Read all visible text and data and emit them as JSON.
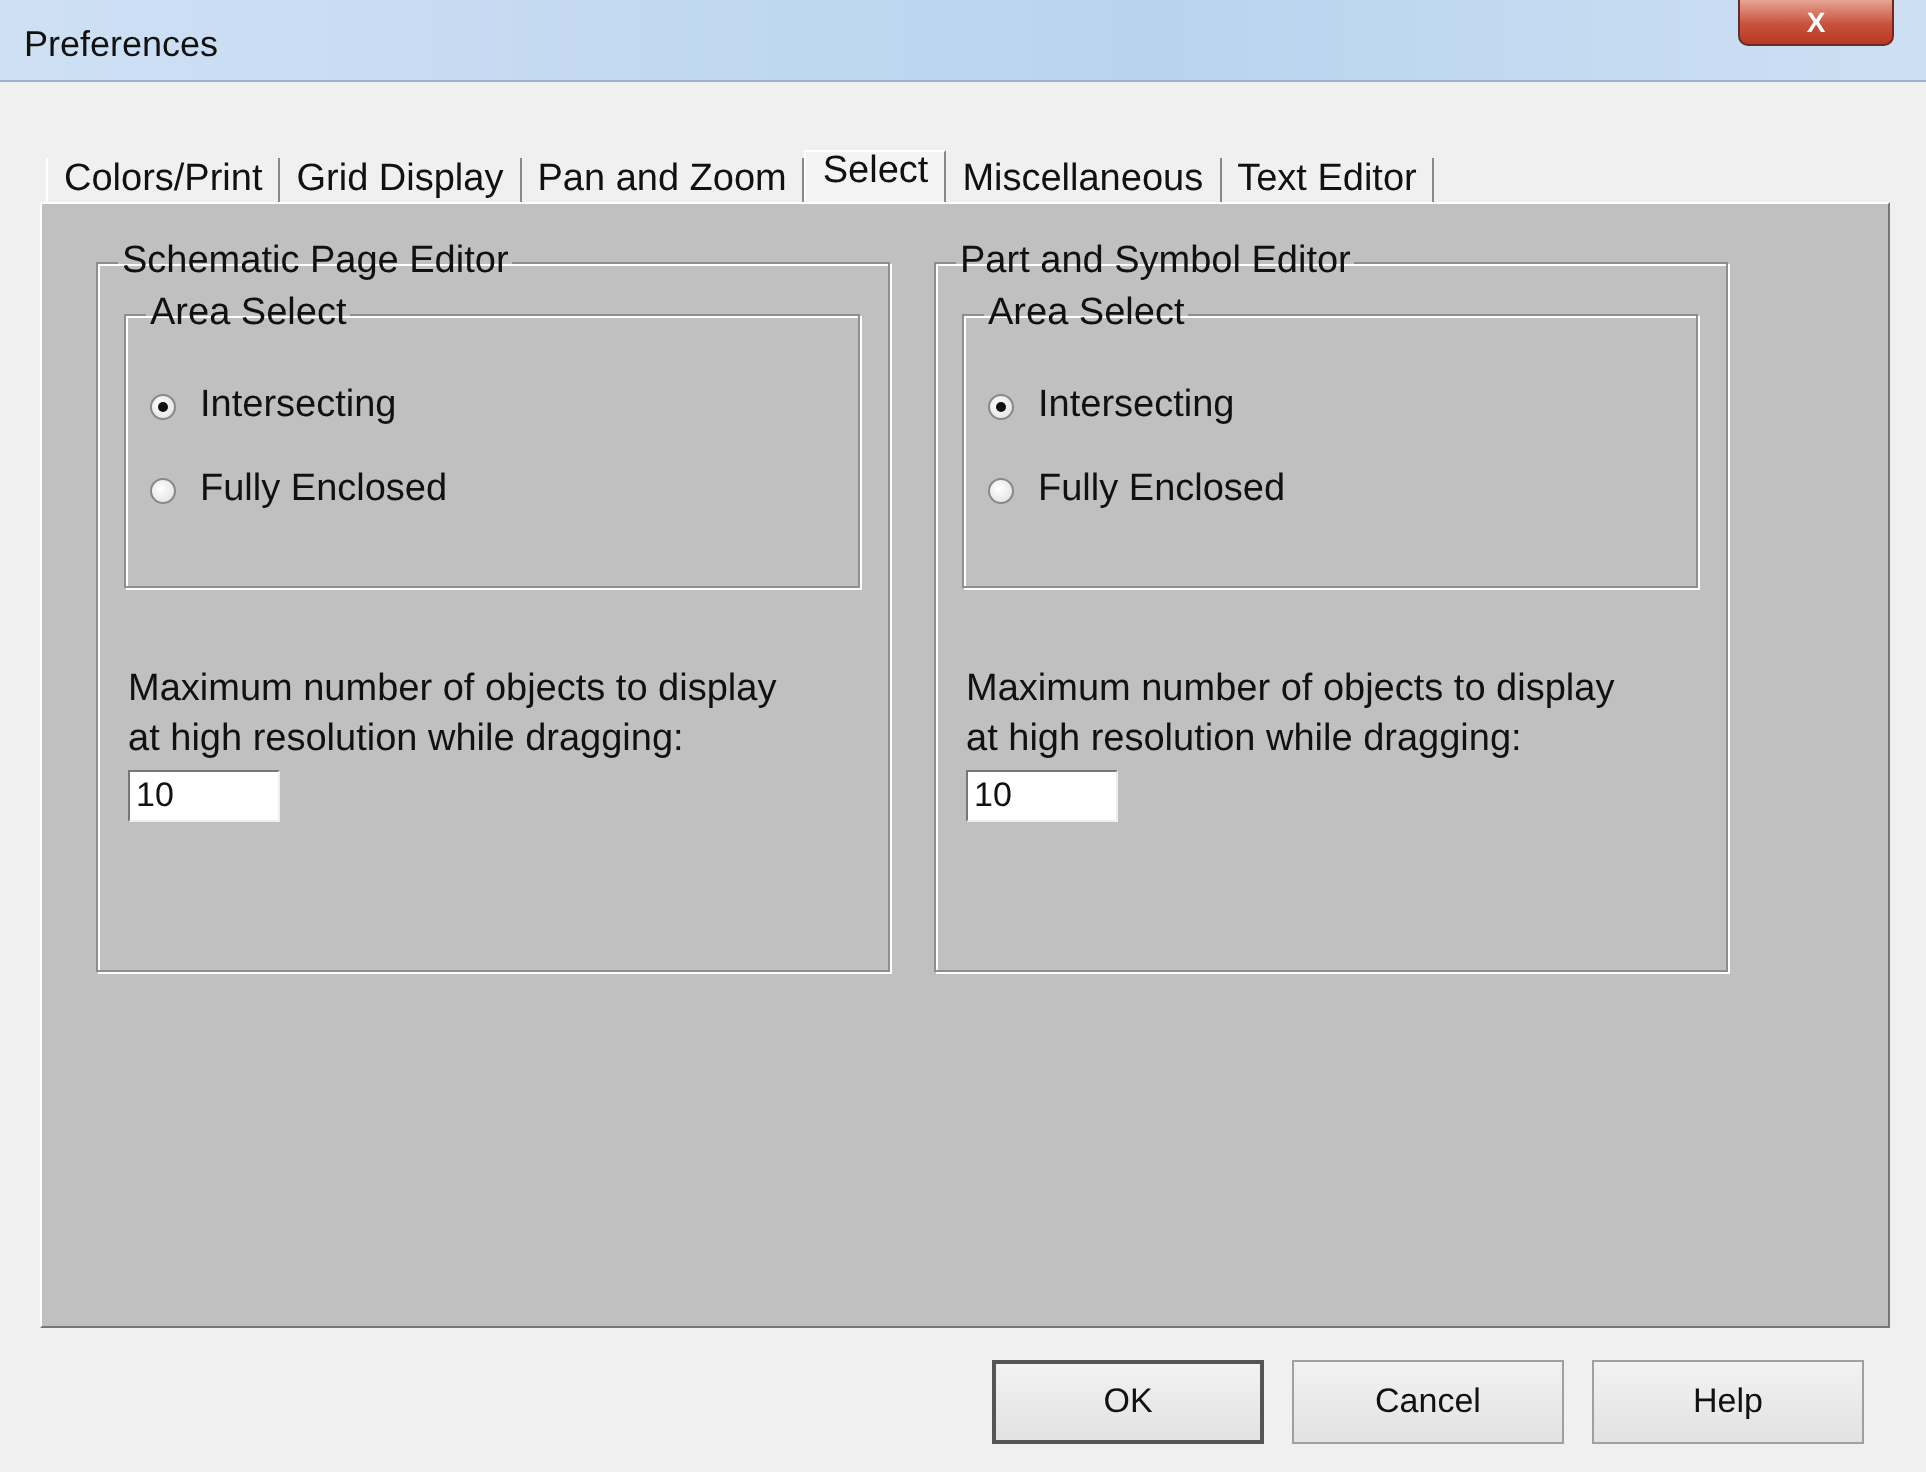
{
  "window": {
    "title": "Preferences",
    "close_label": "X"
  },
  "tabs": [
    {
      "label": "Colors/Print",
      "selected": false
    },
    {
      "label": "Grid Display",
      "selected": false
    },
    {
      "label": "Pan and Zoom",
      "selected": false
    },
    {
      "label": "Select",
      "selected": true
    },
    {
      "label": "Miscellaneous",
      "selected": false
    },
    {
      "label": "Text Editor",
      "selected": false
    }
  ],
  "groups": [
    {
      "title": "Schematic Page Editor",
      "area_select": {
        "title": "Area Select",
        "options": [
          {
            "label": "Intersecting",
            "selected": true
          },
          {
            "label": "Fully Enclosed",
            "selected": false
          }
        ]
      },
      "max_objects_label": "Maximum number of objects to display at high resolution while dragging:",
      "max_objects_value": "10"
    },
    {
      "title": "Part and Symbol Editor",
      "area_select": {
        "title": "Area Select",
        "options": [
          {
            "label": "Intersecting",
            "selected": true
          },
          {
            "label": "Fully Enclosed",
            "selected": false
          }
        ]
      },
      "max_objects_label": "Maximum number of objects to display at high resolution while dragging:",
      "max_objects_value": "10"
    }
  ],
  "buttons": [
    {
      "label": "OK",
      "default": true
    },
    {
      "label": "Cancel",
      "default": false
    },
    {
      "label": "Help",
      "default": false
    }
  ]
}
